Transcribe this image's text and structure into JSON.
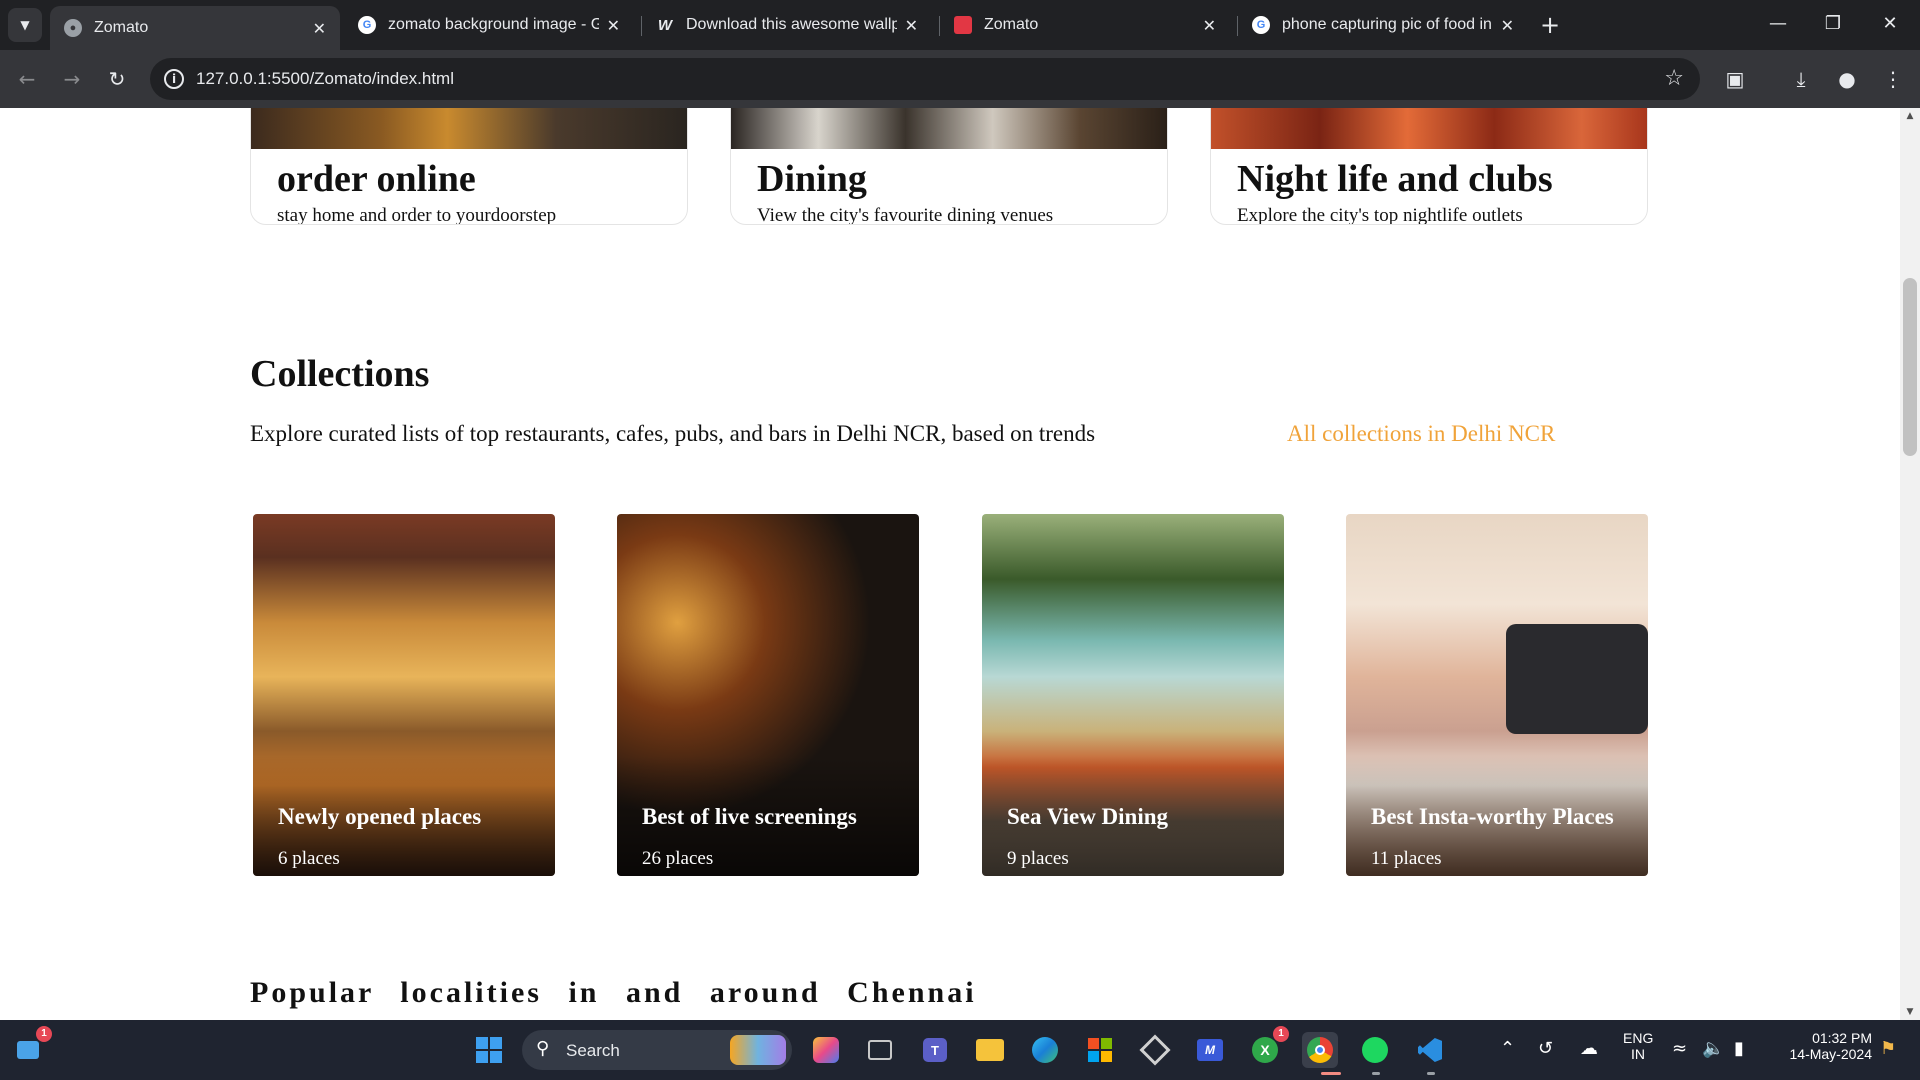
{
  "browser": {
    "tabs": [
      {
        "title": "Zomato",
        "active": true
      },
      {
        "title": "zomato background image - Go",
        "active": false
      },
      {
        "title": "Download this awesome wallpa",
        "active": false
      },
      {
        "title": "Zomato",
        "active": false
      },
      {
        "title": "phone capturing pic of food in",
        "active": false
      }
    ],
    "url": "127.0.0.1:5500/Zomato/index.html"
  },
  "features": [
    {
      "title": "order online",
      "subtitle": "stay home and order to yourdoorstep"
    },
    {
      "title": "Dining",
      "subtitle": "View the city's favourite dining venues"
    },
    {
      "title": "Night life and clubs",
      "subtitle": "Explore the city's top nightlife outlets"
    }
  ],
  "collections": {
    "title": "Collections",
    "description": "Explore curated lists of top restaurants, cafes, pubs, and bars in Delhi NCR, based on trends",
    "link": "All collections in Delhi NCR",
    "cards": [
      {
        "name": "Newly opened places",
        "count": "6 places"
      },
      {
        "name": "Best of live screenings",
        "count": "26 places"
      },
      {
        "name": "Sea View Dining",
        "count": "9 places"
      },
      {
        "name": "Best Insta-worthy Places",
        "count": "11 places"
      }
    ]
  },
  "localities": {
    "prefix": "Popular localities in and around",
    "city": "Chennai"
  },
  "taskbar": {
    "search_placeholder": "Search",
    "language": "ENG",
    "region": "IN",
    "time": "01:32 PM",
    "date": "14-May-2024",
    "widgets_badge": "1",
    "xbox_badge": "1"
  }
}
